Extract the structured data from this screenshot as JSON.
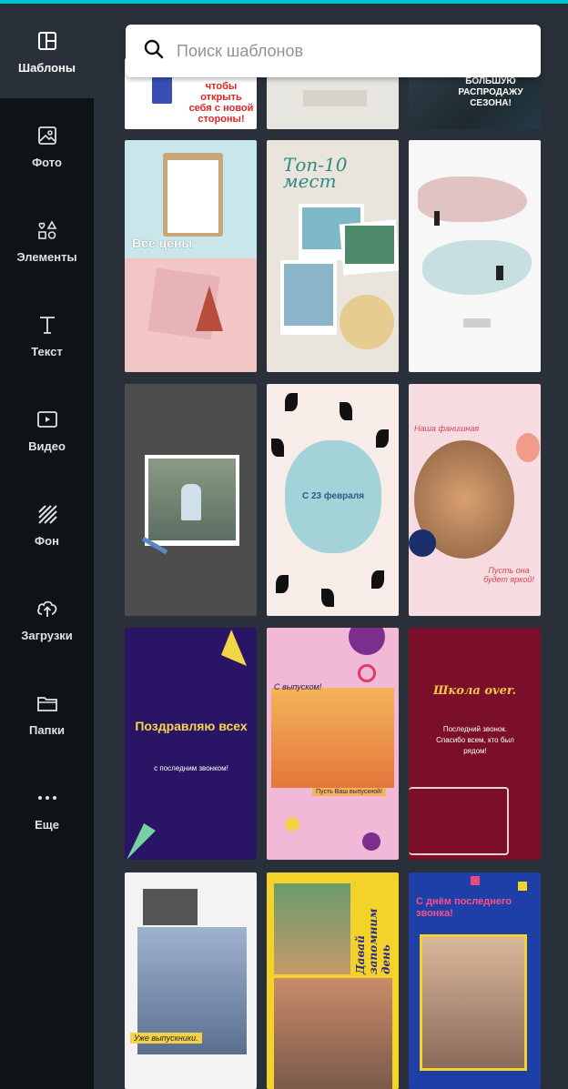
{
  "sidebar": {
    "items": [
      {
        "label": "Шаблоны",
        "icon": "templates-icon"
      },
      {
        "label": "Фото",
        "icon": "photo-icon"
      },
      {
        "label": "Элементы",
        "icon": "elements-icon"
      },
      {
        "label": "Текст",
        "icon": "text-icon"
      },
      {
        "label": "Видео",
        "icon": "video-icon"
      },
      {
        "label": "Фон",
        "icon": "background-icon"
      },
      {
        "label": "Загрузки",
        "icon": "upload-icon"
      },
      {
        "label": "Папки",
        "icon": "folder-icon"
      },
      {
        "label": "Еще",
        "icon": "more-icon"
      }
    ]
  },
  "search": {
    "placeholder": "Поиск шаблонов"
  },
  "templates": {
    "r0c0": {
      "text": "чтобы открыть себя с новой стороны!"
    },
    "r0c2": {
      "text": "БОЛЬШУЮ РАСПРОДАЖУ СЕЗОНА!"
    },
    "r1c0": {
      "text": "Все цены"
    },
    "r1c1": {
      "text": "Топ-10 мест"
    },
    "r2c1": {
      "text": "С 23 февраля"
    },
    "r2c2": {
      "top": "Наша фанишная",
      "bottom": "Пусть она будет яркой!"
    },
    "r3c0": {
      "text": "Поздравляю всех",
      "sub": "с последним звонком!"
    },
    "r3c1": {
      "top": "С выпуском!",
      "bottom": "Пусть Ваш выпускной!"
    },
    "r3c2": {
      "text": "Школа over.",
      "sub": "Последний звонок. Спасибо всем, кто был рядом!"
    },
    "r4c0": {
      "text": "Уже выпускники."
    },
    "r4c1": {
      "text": "Давай запомним день"
    },
    "r4c2": {
      "text": "С днём последнего звонка!"
    }
  },
  "colors": {
    "sidebar": "#0e1318",
    "panel": "#293039",
    "accent": "#00c4cc"
  }
}
